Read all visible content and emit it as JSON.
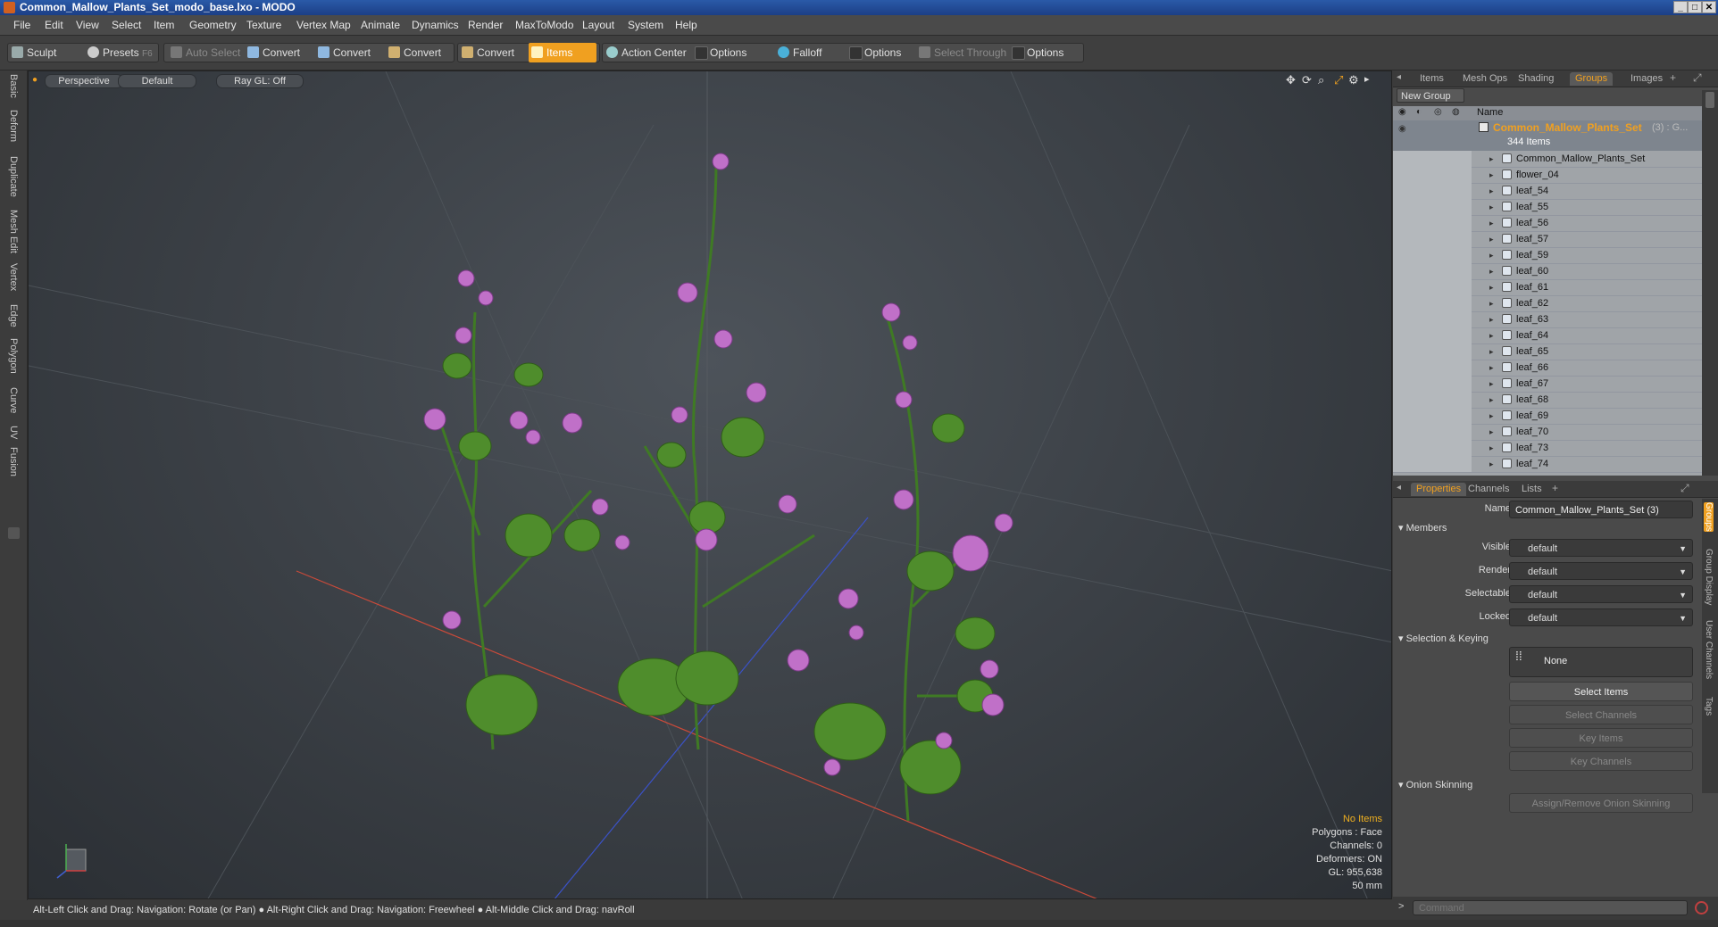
{
  "window": {
    "title": "Common_Mallow_Plants_Set_modo_base.lxo - MODO"
  },
  "menu": [
    "File",
    "Edit",
    "View",
    "Select",
    "Item",
    "Geometry",
    "Texture",
    "Vertex Map",
    "Animate",
    "Dynamics",
    "Render",
    "MaxToModo",
    "Layout",
    "System",
    "Help"
  ],
  "toolbar": {
    "sculpt": "Sculpt",
    "presets": "Presets",
    "presets_key": "F6",
    "auto_select": "Auto Select",
    "convert1": "Convert",
    "convert2": "Convert",
    "convert3": "Convert",
    "convert4": "Convert",
    "items": "Items",
    "action_center": "Action Center",
    "options1": "Options",
    "falloff": "Falloff",
    "options2": "Options",
    "select_through": "Select Through",
    "options3": "Options"
  },
  "left_tabs": [
    "Basic",
    "Deform",
    "Duplicate",
    "Mesh Edit",
    "Vertex",
    "Edge",
    "Polygon",
    "Curve",
    "UV",
    "Fusion"
  ],
  "viewport": {
    "view": "Perspective",
    "shading": "Default",
    "raygl": "Ray GL: Off",
    "info": {
      "selection": "No Items",
      "polygons": "Polygons : Face",
      "channels": "Channels: 0",
      "deformers": "Deformers: ON",
      "gl": "GL: 955,638",
      "scale": "50 mm"
    }
  },
  "status_bar": "Alt-Left Click and Drag: Navigation: Rotate (or Pan) ● Alt-Right Click and Drag: Navigation: Freewheel ● Alt-Middle Click and Drag: navRoll",
  "right_top_tabs": [
    "Items",
    "Mesh Ops",
    "Shading",
    "Groups",
    "Images"
  ],
  "right_top_active": "Groups",
  "groups": {
    "new_group": "New Group",
    "name_col": "Name",
    "group_name": "Common_Mallow_Plants_Set",
    "group_suffix": "(3) : G...",
    "item_count": "344 Items",
    "items": [
      "Common_Mallow_Plants_Set",
      "flower_04",
      "leaf_54",
      "leaf_55",
      "leaf_56",
      "leaf_57",
      "leaf_59",
      "leaf_60",
      "leaf_61",
      "leaf_62",
      "leaf_63",
      "leaf_64",
      "leaf_65",
      "leaf_66",
      "leaf_67",
      "leaf_68",
      "leaf_69",
      "leaf_70",
      "leaf_73",
      "leaf_74"
    ]
  },
  "right_bottom_tabs": [
    "Properties",
    "Channels",
    "Lists"
  ],
  "right_vtabs": [
    "Groups",
    "Group Display",
    "User Channels",
    "Tags"
  ],
  "properties": {
    "name_label": "Name",
    "name_value": "Common_Mallow_Plants_Set (3)",
    "members": "Members",
    "visible_label": "Visible",
    "visible_value": "default",
    "render_label": "Render",
    "render_value": "default",
    "selectable_label": "Selectable",
    "selectable_value": "default",
    "locked_label": "Locked",
    "locked_value": "default",
    "selection_keying": "Selection & Keying",
    "none_label": "None",
    "select_items": "Select Items",
    "select_channels": "Select Channels",
    "key_items": "Key Items",
    "key_channels": "Key Channels",
    "onion_skinning": "Onion Skinning",
    "assign_onion": "Assign/Remove Onion Skinning"
  },
  "command": {
    "placeholder": "Command"
  }
}
